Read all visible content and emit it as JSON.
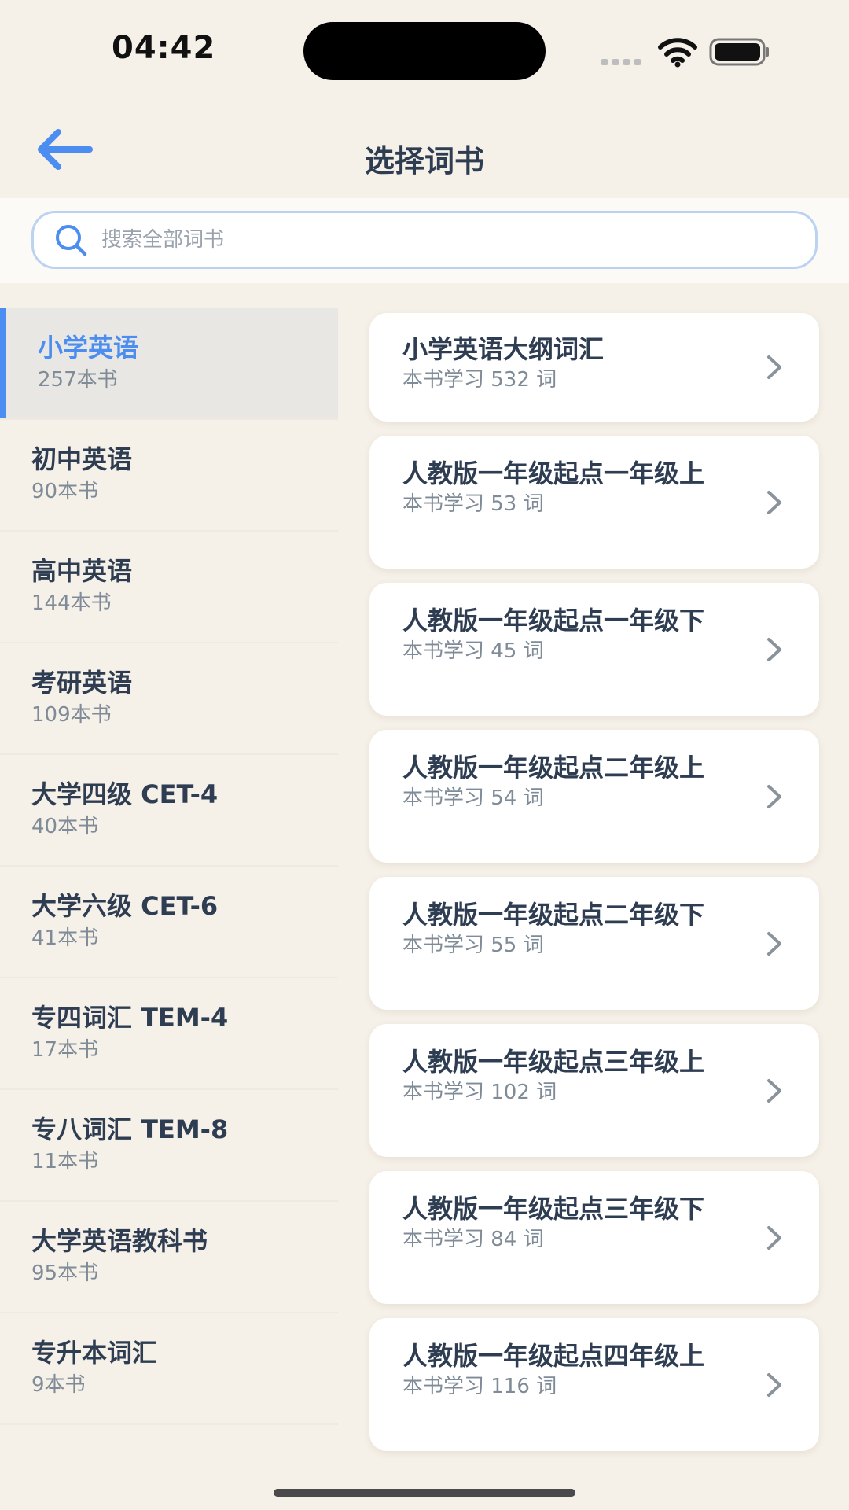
{
  "status_bar": {
    "time": "04:42"
  },
  "nav": {
    "title": "选择词书"
  },
  "search": {
    "placeholder": "搜索全部词书"
  },
  "sidebar": {
    "items": [
      {
        "name": "小学英语",
        "count": "257本书"
      },
      {
        "name": "初中英语",
        "count": "90本书"
      },
      {
        "name": "高中英语",
        "count": "144本书"
      },
      {
        "name": "考研英语",
        "count": "109本书"
      },
      {
        "name": "大学四级 CET-4",
        "count": "40本书"
      },
      {
        "name": "大学六级 CET-6",
        "count": "41本书"
      },
      {
        "name": "专四词汇 TEM-4",
        "count": "17本书"
      },
      {
        "name": "专八词汇 TEM-8",
        "count": "11本书"
      },
      {
        "name": "大学英语教科书",
        "count": "95本书"
      },
      {
        "name": "专升本词汇",
        "count": "9本书"
      }
    ]
  },
  "books": [
    {
      "title": "小学英语大纲词汇",
      "words": "本书学习 532 词"
    },
    {
      "title": "人教版一年级起点一年级上",
      "words": "本书学习 53 词"
    },
    {
      "title": "人教版一年级起点一年级下",
      "words": "本书学习 45 词"
    },
    {
      "title": "人教版一年级起点二年级上",
      "words": "本书学习 54 词"
    },
    {
      "title": "人教版一年级起点二年级下",
      "words": "本书学习 55 词"
    },
    {
      "title": "人教版一年级起点三年级上",
      "words": "本书学习 102 词"
    },
    {
      "title": "人教版一年级起点三年级下",
      "words": "本书学习 84 词"
    },
    {
      "title": "人教版一年级起点四年级上",
      "words": "本书学习 116 词"
    }
  ],
  "colors": {
    "accent": "#4b8df0",
    "background": "#f5f0e8",
    "card": "#ffffff",
    "text": "#2e3d52",
    "muted": "#7f8b97"
  }
}
